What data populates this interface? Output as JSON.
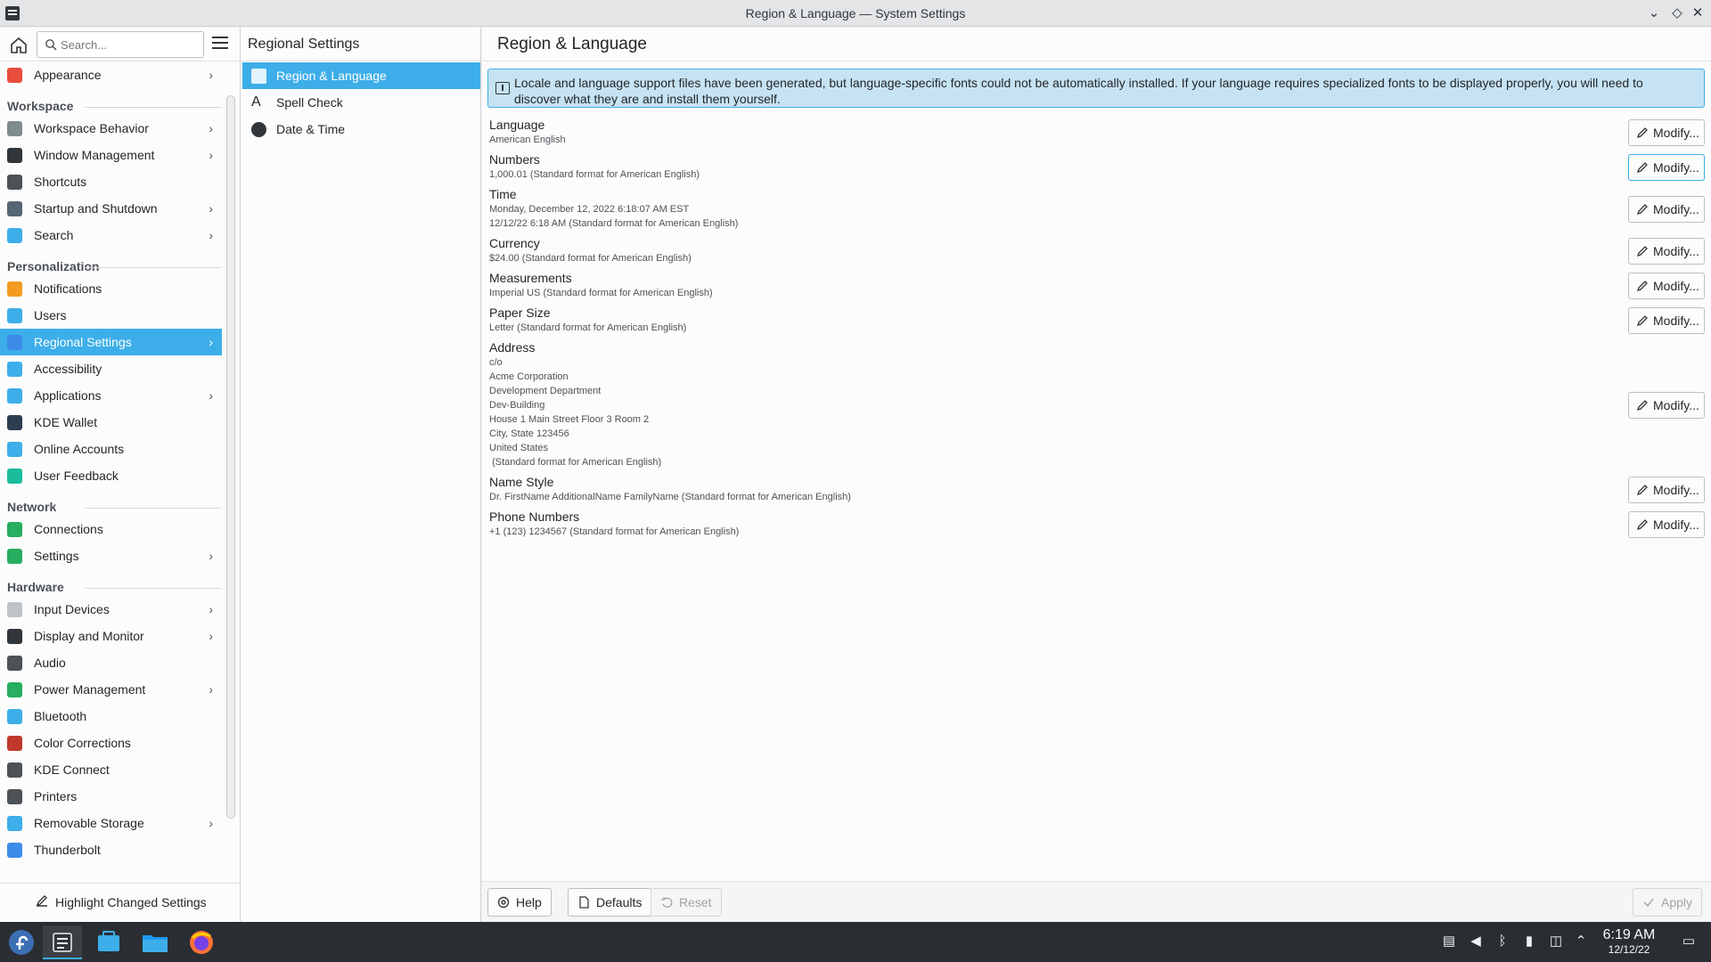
{
  "window": {
    "title": "Region & Language — System Settings",
    "controls": [
      "minimize",
      "maximize",
      "close"
    ]
  },
  "sidebar": {
    "search_placeholder": "Search...",
    "items": [
      {
        "type": "item",
        "name": "appearance",
        "label": "Appearance",
        "chevron": true,
        "icon": "appearance-icon",
        "color": "#e74c3c"
      },
      {
        "type": "section",
        "label": "Workspace"
      },
      {
        "type": "item",
        "name": "workspace-behavior",
        "label": "Workspace Behavior",
        "chevron": true,
        "icon": "workspace-behavior-icon",
        "color": "#7f8c8d"
      },
      {
        "type": "item",
        "name": "window-management",
        "label": "Window Management",
        "chevron": true,
        "icon": "window-management-icon",
        "color": "#31363b"
      },
      {
        "type": "item",
        "name": "shortcuts",
        "label": "Shortcuts",
        "chevron": false,
        "icon": "keyboard-icon",
        "color": "#4d5257"
      },
      {
        "type": "item",
        "name": "startup-shutdown",
        "label": "Startup and Shutdown",
        "chevron": true,
        "icon": "startup-icon",
        "color": "#566573"
      },
      {
        "type": "item",
        "name": "search",
        "label": "Search",
        "chevron": true,
        "icon": "search-icon",
        "color": "#3daee9"
      },
      {
        "type": "section",
        "label": "Personalization"
      },
      {
        "type": "item",
        "name": "notifications",
        "label": "Notifications",
        "chevron": false,
        "icon": "bell-icon",
        "color": "#f39c1f"
      },
      {
        "type": "item",
        "name": "users",
        "label": "Users",
        "chevron": false,
        "icon": "users-icon",
        "color": "#3daee9"
      },
      {
        "type": "item",
        "name": "regional-settings",
        "label": "Regional Settings",
        "chevron": true,
        "icon": "regional-settings-icon",
        "color": "#3d8be9",
        "active": true
      },
      {
        "type": "item",
        "name": "accessibility",
        "label": "Accessibility",
        "chevron": false,
        "icon": "accessibility-icon",
        "color": "#3daee9"
      },
      {
        "type": "item",
        "name": "applications",
        "label": "Applications",
        "chevron": true,
        "icon": "applications-icon",
        "color": "#3daee9"
      },
      {
        "type": "item",
        "name": "kde-wallet",
        "label": "KDE Wallet",
        "chevron": false,
        "icon": "wallet-icon",
        "color": "#2c3e50"
      },
      {
        "type": "item",
        "name": "online-accounts",
        "label": "Online Accounts",
        "chevron": false,
        "icon": "online-accounts-icon",
        "color": "#3daee9"
      },
      {
        "type": "item",
        "name": "user-feedback",
        "label": "User Feedback",
        "chevron": false,
        "icon": "feedback-icon",
        "color": "#1abc9c"
      },
      {
        "type": "section",
        "label": "Network"
      },
      {
        "type": "item",
        "name": "connections",
        "label": "Connections",
        "chevron": false,
        "icon": "globe-icon",
        "color": "#27ae60"
      },
      {
        "type": "item",
        "name": "network-settings",
        "label": "Settings",
        "chevron": true,
        "icon": "globe-icon",
        "color": "#27ae60"
      },
      {
        "type": "section",
        "label": "Hardware"
      },
      {
        "type": "item",
        "name": "input-devices",
        "label": "Input Devices",
        "chevron": true,
        "icon": "mouse-icon",
        "color": "#bdc3c7"
      },
      {
        "type": "item",
        "name": "display-monitor",
        "label": "Display and Monitor",
        "chevron": true,
        "icon": "monitor-icon",
        "color": "#31363b"
      },
      {
        "type": "item",
        "name": "audio",
        "label": "Audio",
        "chevron": false,
        "icon": "speaker-icon",
        "color": "#4d5257"
      },
      {
        "type": "item",
        "name": "power-management",
        "label": "Power Management",
        "chevron": true,
        "icon": "power-icon",
        "color": "#27ae60"
      },
      {
        "type": "item",
        "name": "bluetooth",
        "label": "Bluetooth",
        "chevron": false,
        "icon": "bluetooth-icon",
        "color": "#3daee9"
      },
      {
        "type": "item",
        "name": "color-corrections",
        "label": "Color Corrections",
        "chevron": false,
        "icon": "color-icon",
        "color": "#c0392b"
      },
      {
        "type": "item",
        "name": "kde-connect",
        "label": "KDE Connect",
        "chevron": false,
        "icon": "phone-icon",
        "color": "#4d5257"
      },
      {
        "type": "item",
        "name": "printers",
        "label": "Printers",
        "chevron": false,
        "icon": "printer-icon",
        "color": "#4d5257"
      },
      {
        "type": "item",
        "name": "removable-storage",
        "label": "Removable Storage",
        "chevron": true,
        "icon": "usb-icon",
        "color": "#3daee9"
      },
      {
        "type": "item",
        "name": "thunderbolt",
        "label": "Thunderbolt",
        "chevron": false,
        "icon": "thunderbolt-icon",
        "color": "#3d8be9"
      }
    ],
    "highlight_label": "Highlight Changed Settings"
  },
  "middle": {
    "title": "Regional Settings",
    "items": [
      {
        "name": "region-language",
        "label": "Region & Language",
        "icon": "region-language-icon",
        "active": true
      },
      {
        "name": "spell-check",
        "label": "Spell Check",
        "icon": "spell-check-icon",
        "active": false
      },
      {
        "name": "date-time",
        "label": "Date & Time",
        "icon": "clock-icon",
        "active": false
      }
    ]
  },
  "content": {
    "title": "Region & Language",
    "info": "Locale and language support files have been generated, but language-specific fonts could not be automatically installed. If your language requires specialized fonts to be displayed properly, you will need to discover what they are and install them yourself.",
    "modify_label": "Modify...",
    "rows": [
      {
        "name": "language",
        "label": "Language",
        "value": "American English"
      },
      {
        "name": "numbers",
        "label": "Numbers",
        "value": "1,000.01 (Standard format for American English)"
      },
      {
        "name": "time",
        "label": "Time",
        "value": "Monday, December 12, 2022 6:18:07 AM EST\n12/12/22 6:18 AM (Standard format for American English)"
      },
      {
        "name": "currency",
        "label": "Currency",
        "value": "$24.00 (Standard format for American English)"
      },
      {
        "name": "measurements",
        "label": "Measurements",
        "value": "Imperial US (Standard format for American English)"
      },
      {
        "name": "paper-size",
        "label": "Paper Size",
        "value": "Letter (Standard format for American English)"
      },
      {
        "name": "address",
        "label": "Address",
        "value": "c/o\nAcme Corporation\nDevelopment Department\nDev-Building\nHouse 1 Main Street Floor 3 Room 2\nCity, State 123456\nUnited States\n (Standard format for American English)"
      },
      {
        "name": "name-style",
        "label": "Name Style",
        "value": "Dr. FirstName AdditionalName FamilyName (Standard format for American English)"
      },
      {
        "name": "phone-numbers",
        "label": "Phone Numbers",
        "value": "+1 (123) 1234567 (Standard format for American English)"
      }
    ],
    "footer": {
      "help": "Help",
      "defaults": "Defaults",
      "reset": "Reset",
      "apply": "Apply"
    }
  },
  "taskbar": {
    "time": "6:19 AM",
    "date": "12/12/22",
    "apps": [
      "fedora-launcher-icon",
      "system-settings-icon",
      "discover-icon",
      "dolphin-icon",
      "firefox-icon"
    ],
    "tray": [
      "clipboard-icon",
      "volume-icon",
      "bluetooth-icon",
      "battery-icon",
      "network-icon",
      "expand-tray-icon"
    ]
  },
  "colors": {
    "accent": "#3daee9",
    "taskbar": "#2a2e32",
    "info_bg": "#c6e3f3"
  }
}
